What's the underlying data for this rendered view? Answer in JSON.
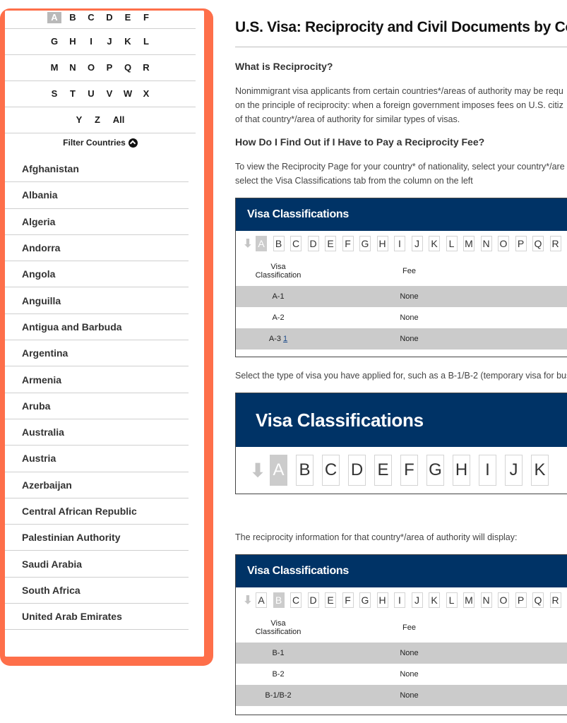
{
  "sidebar": {
    "alphabet_rows": [
      [
        "A",
        "B",
        "C",
        "D",
        "E",
        "F"
      ],
      [
        "G",
        "H",
        "I",
        "J",
        "K",
        "L"
      ],
      [
        "M",
        "N",
        "O",
        "P",
        "Q",
        "R"
      ],
      [
        "S",
        "T",
        "U",
        "V",
        "W",
        "X"
      ],
      [
        "Y",
        "Z",
        "All"
      ]
    ],
    "active_letter": "A",
    "filter_label": "Filter Countries",
    "countries": [
      "Afghanistan",
      "Albania",
      "Algeria",
      "Andorra",
      "Angola",
      "Anguilla",
      "Antigua and Barbuda",
      "Argentina",
      "Armenia",
      "Aruba",
      "Australia",
      "Austria",
      "Azerbaijan",
      "Central African Republic",
      "Palestinian Authority",
      "Saudi Arabia",
      "South Africa",
      "United Arab Emirates"
    ],
    "highlight_color": "#fe6f4a"
  },
  "main": {
    "title": "U.S. Visa: Reciprocity and Civil Documents by Country",
    "section1_heading": "What is Reciprocity?",
    "section1_lines": [
      "Nonimmigrant visa applicants from certain countries*/areas of authority may be requ",
      "on the principle of  reciprocity:  when a foreign government imposes fees on U.S. citiz",
      "of that country*/area of authority for similar types of visas."
    ],
    "section2_heading": "How Do I Find Out if I Have to Pay a Reciprocity Fee?",
    "section2_lines": [
      "To view the Reciprocity Page for your country* of nationality, select your country*/are",
      "select the Visa Classifications tab from the column on the left"
    ],
    "select_instruction": "Select the type of visa you have applied for, such as a B-1/B-2 (temporary visa for bus",
    "display_instruction": "The reciprocity information for that country*/area of authority will display:",
    "header_color": "#003366"
  },
  "example1": {
    "title": "Visa Classifications",
    "letters": [
      "A",
      "B",
      "C",
      "D",
      "E",
      "F",
      "G",
      "H",
      "I",
      "J",
      "K",
      "L",
      "M",
      "N",
      "O",
      "P",
      "Q",
      "R"
    ],
    "active_letter": "A",
    "col_classification": "Visa Classification",
    "col_fee": "Fee",
    "rows": [
      {
        "classification": "A-1",
        "fee": "None"
      },
      {
        "classification": "A-2",
        "fee": "None"
      },
      {
        "classification": "A-3",
        "footnote": "1",
        "fee": "None"
      }
    ]
  },
  "example2": {
    "title": "Visa Classifications",
    "letters": [
      "A",
      "B",
      "C",
      "D",
      "E",
      "F",
      "G",
      "H",
      "I",
      "J",
      "K"
    ],
    "active_letter": "A"
  },
  "example3": {
    "title": "Visa Classifications",
    "letters": [
      "A",
      "B",
      "C",
      "D",
      "E",
      "F",
      "G",
      "H",
      "I",
      "J",
      "K",
      "L",
      "M",
      "N",
      "O",
      "P",
      "Q",
      "R"
    ],
    "active_letter": "B",
    "col_classification": "Visa Classification",
    "col_fee": "Fee",
    "rows": [
      {
        "classification": "B-1",
        "fee": "None"
      },
      {
        "classification": "B-2",
        "fee": "None"
      },
      {
        "classification": "B-1/B-2",
        "fee": "None"
      }
    ]
  }
}
